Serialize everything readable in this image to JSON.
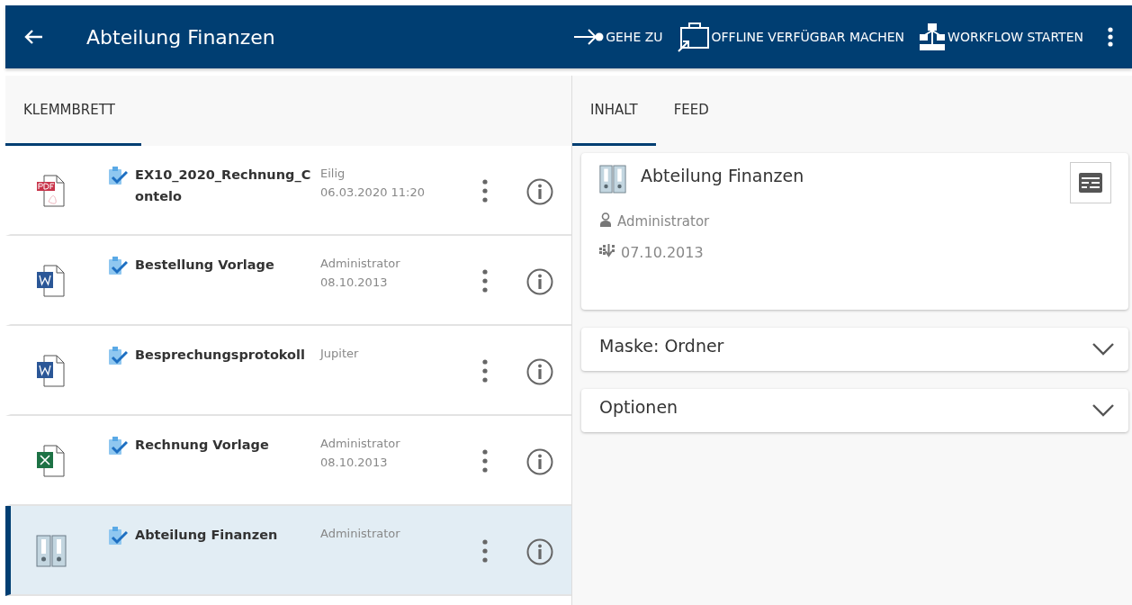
{
  "header": {
    "title": "Abteilung Finanzen",
    "actions": [
      {
        "kind": "goto",
        "label": "GEHE ZU"
      },
      {
        "kind": "offline",
        "label": "OFFLINE VERFÜGBAR MACHEN"
      },
      {
        "kind": "workflow",
        "label": "WORKFLOW STARTEN"
      }
    ]
  },
  "left_tabs": [
    {
      "label": "KLEMMBRETT",
      "selected": true
    }
  ],
  "items": [
    {
      "kind": "pdf",
      "title": "EX10_2020_Rechnung_Contelo",
      "meta": [
        "Eilig",
        "06.03.2020 11:20"
      ],
      "selected": false
    },
    {
      "kind": "word",
      "title": "Bestellung Vorlage",
      "meta": [
        "Administrator",
        "08.10.2013"
      ],
      "selected": false
    },
    {
      "kind": "word",
      "title": "Besprechungsprotokoll",
      "meta": [
        "Jupiter"
      ],
      "selected": false
    },
    {
      "kind": "excel",
      "title": "Rechnung Vorlage",
      "meta": [
        "Administrator",
        "08.10.2013"
      ],
      "selected": false
    },
    {
      "kind": "folder",
      "title": "Abteilung Finanzen",
      "meta": [
        "Administrator"
      ],
      "selected": true
    }
  ],
  "right_tabs": [
    {
      "label": "INHALT",
      "selected": true
    },
    {
      "label": "FEED",
      "selected": false
    }
  ],
  "detail": {
    "title": "Abteilung Finanzen",
    "owner": "Administrator",
    "date": "07.10.2013"
  },
  "sections": [
    {
      "label": "Maske: Ordner",
      "expanded": false
    },
    {
      "label": "Optionen",
      "expanded": false
    }
  ]
}
